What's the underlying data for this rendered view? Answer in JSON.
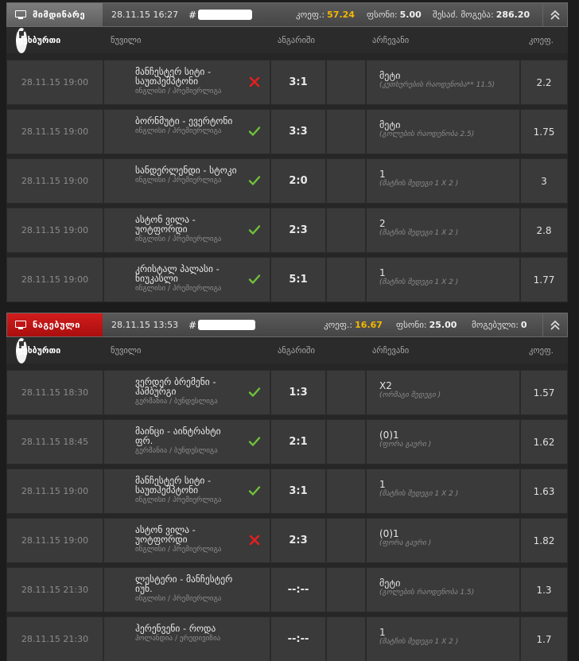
{
  "columns": {
    "sport": "ფეხბურთი",
    "event": "ნუვილი",
    "score": "ანგარიში",
    "pick": "არჩევანი",
    "odds": "კოეფ."
  },
  "colors": {
    "accent": "#f5b800",
    "won": "#c41414",
    "win_mark": "#6fc13b",
    "loss_mark": "#e22020"
  },
  "icons": [
    "monitor-icon",
    "collapse-icon",
    "soccer-ball-icon",
    "check-icon",
    "cross-icon"
  ],
  "tickets": [
    {
      "status": "მიმდინარე",
      "status_type": "current",
      "date": "28.11.15 16:27",
      "id_prefix": "#",
      "odds_label": "კოეფ.:",
      "odds_value": "57.24",
      "stake_label": "ფსონი:",
      "stake_value": "5.00",
      "payout_label": "შესაძ. მოგება:",
      "payout_value": "286.20",
      "rows": [
        {
          "date": "28.11.15 19:00",
          "event": "მანჩესტერ სიტი - საუთჰემპტონი",
          "league": "ინგლისი / პრემიერლიგა",
          "result": "loss",
          "score": "3:1",
          "pick": "მეტი",
          "pick_sub": "(კუთხურების რაოდენობა** 11.5)",
          "odds": "2.2"
        },
        {
          "date": "28.11.15 19:00",
          "event": "ბორნმუტი - ევერტონი",
          "league": "ინგლისი / პრემიერლიგა",
          "result": "win",
          "score": "3:3",
          "pick": "მეტი",
          "pick_sub": "(გოლების რაოდენობა 2.5)",
          "odds": "1.75"
        },
        {
          "date": "28.11.15 19:00",
          "event": "სანდერლენდი - სტოკი",
          "league": "ინგლისი / პრემიერლიგა",
          "result": "win",
          "score": "2:0",
          "pick": "1",
          "pick_sub": "(მატჩის შედეგი 1 X 2 )",
          "odds": "3"
        },
        {
          "date": "28.11.15 19:00",
          "event": "ასტონ ვილა - უოტფორდი",
          "league": "ინგლისი / პრემიერლიგა",
          "result": "win",
          "score": "2:3",
          "pick": "2",
          "pick_sub": "(მატჩის შედეგი 1 X 2 )",
          "odds": "2.8"
        },
        {
          "date": "28.11.15 19:00",
          "event": "კრისტალ პალასი - ნიუკასლი",
          "league": "ინგლისი / პრემიერლიგა",
          "result": "win",
          "score": "5:1",
          "pick": "1",
          "pick_sub": "(მატჩის შედეგი 1 X 2 )",
          "odds": "1.77"
        }
      ]
    },
    {
      "status": "ნაგებული",
      "status_type": "won",
      "date": "28.11.15 13:53",
      "id_prefix": "#",
      "odds_label": "კოეფ.:",
      "odds_value": "16.67",
      "stake_label": "ფსონი:",
      "stake_value": "25.00",
      "payout_label": "მოგებული:",
      "payout_value": "0",
      "rows": [
        {
          "date": "28.11.15 18:30",
          "event": "ვერდერ ბრემენი - ჰამბურგი",
          "league": "გერმანია / ბუნდესლიგა",
          "result": "win",
          "score": "1:3",
          "pick": "X2",
          "pick_sub": "(ორმაგი შედეგი )",
          "odds": "1.57"
        },
        {
          "date": "28.11.15 18:45",
          "event": "მაინცი - აინტრახტი ფრ.",
          "league": "გერმანია / ბუნდესლიგა",
          "result": "win",
          "score": "2:1",
          "pick": "(0)1",
          "pick_sub": "(ფორა გაური )",
          "odds": "1.62"
        },
        {
          "date": "28.11.15 19:00",
          "event": "მანჩესტერ სიტი - საუთჰემპტონი",
          "league": "ინგლისი / პრემიერლიგა",
          "result": "win",
          "score": "3:1",
          "pick": "1",
          "pick_sub": "(მატჩის შედეგი 1 X 2 )",
          "odds": "1.63"
        },
        {
          "date": "28.11.15 19:00",
          "event": "ასტონ ვილა - უოტფორდი",
          "league": "ინგლისი / პრემიერლიგა",
          "result": "loss",
          "score": "2:3",
          "pick": "(0)1",
          "pick_sub": "(ფორა გაური )",
          "odds": "1.82"
        },
        {
          "date": "28.11.15 21:30",
          "event": "ლესტერი - მანჩესტერ იუნ.",
          "league": "ინგლისი / პრემიერლიგა",
          "result": "none",
          "score": "--:--",
          "pick": "მეტი",
          "pick_sub": "(გოლების რაოდენობა 1.5)",
          "odds": "1.3"
        },
        {
          "date": "28.11.15 21:30",
          "event": "ჰერენვენი - როდა",
          "league": "ჰოლანდია / ერედივიზია",
          "result": "none",
          "score": "--:--",
          "pick": "1",
          "pick_sub": "(მატჩის შედეგი 1 X 2 )",
          "odds": "1.7"
        }
      ]
    }
  ]
}
